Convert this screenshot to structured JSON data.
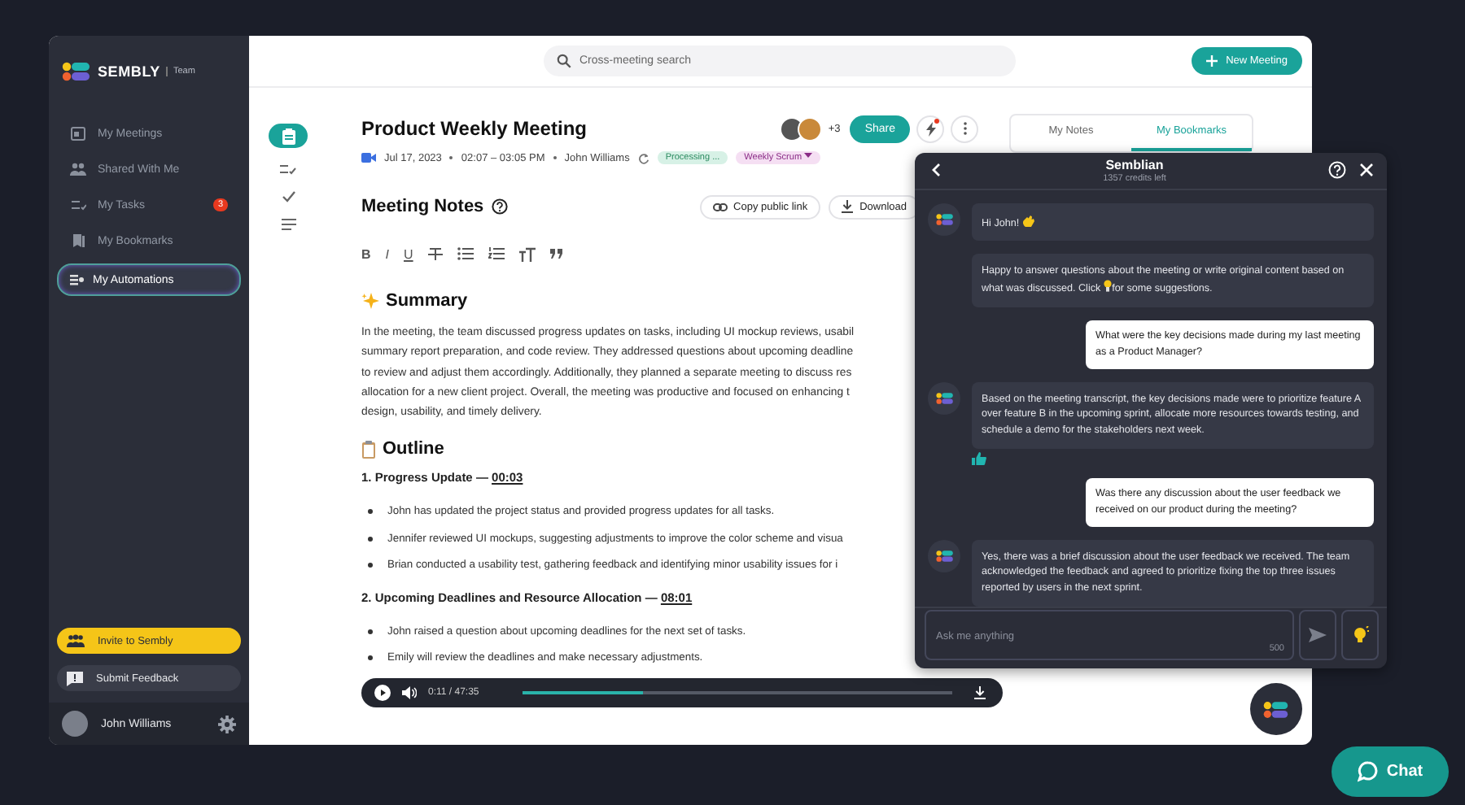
{
  "sidebar": {
    "brand": "SEMBLY",
    "edition": "Team",
    "items": [
      {
        "label": "My Meetings",
        "selected": false
      },
      {
        "label": "Shared With Me",
        "selected": false
      },
      {
        "label": "My Tasks",
        "selected": false,
        "badge": "3"
      },
      {
        "label": "My Bookmarks",
        "selected": false
      },
      {
        "label": "My Automations",
        "selected": true
      }
    ],
    "invite_button": "Invite to Sembly",
    "feedback_button": "Submit Feedback",
    "user_name": "John Williams"
  },
  "search": {
    "placeholder": "Cross-meeting search"
  },
  "new_meeting_button": "New Meeting",
  "meeting": {
    "title": "Product Weekly Meeting",
    "date": "Jul 17, 2023",
    "time": "02:07 – 03:05 PM",
    "host": "John Williams",
    "status_tag": "Processing ...",
    "type_tag": "Weekly Scrum",
    "extra_participants": "+3",
    "share_button": "Share"
  },
  "side_tabs": [
    {
      "label": "My Notes",
      "selected": false
    },
    {
      "label": "My Bookmarks",
      "selected": true
    }
  ],
  "notes": {
    "heading": "Meeting Notes",
    "copy_link_button": "Copy public link",
    "download_button": "Download",
    "toolbar": [
      {
        "kind": "bold",
        "label": "B"
      },
      {
        "kind": "italic",
        "label": "I"
      },
      {
        "kind": "underline",
        "label": "U"
      },
      {
        "kind": "strike"
      },
      {
        "kind": "bullets"
      },
      {
        "kind": "numbered"
      },
      {
        "kind": "textsize"
      },
      {
        "kind": "quote"
      }
    ],
    "summary_heading": "Summary",
    "summary_lines": [
      "In the meeting, the team discussed progress updates on tasks, including UI mockup reviews, usabil",
      "summary report preparation, and code review. They addressed questions about upcoming deadline",
      "to review and adjust them accordingly. Additionally, they planned a separate meeting to discuss res",
      "allocation for a new client project. Overall, the meeting was productive and focused on enhancing t",
      "design, usability, and timely delivery."
    ],
    "outline_heading": "Outline",
    "sections": [
      {
        "title": "1. Progress Update —",
        "timestamp": "00:03",
        "bullets": [
          "John has updated the project status and provided progress updates for all tasks.",
          "Jennifer reviewed UI mockups, suggesting adjustments to improve the color scheme and visua",
          "Brian conducted a usability test, gathering feedback and identifying minor usability issues for i"
        ]
      },
      {
        "title": "2. Upcoming Deadlines and Resource Allocation —",
        "timestamp": "08:01",
        "bullets": [
          "John raised a question about upcoming deadlines for the next set of tasks.",
          "Emily will review the deadlines and make necessary adjustments."
        ]
      }
    ]
  },
  "player": {
    "time": "0:11 / 47:35",
    "level": 0.28
  },
  "assistant": {
    "title": "Semblian",
    "credits": "1357 credits left",
    "messages": [
      {
        "kind": "bot",
        "liked": false,
        "bubbles": [
          {
            "kind": "greeting",
            "text": "Hi John!"
          },
          {
            "kind": "hint",
            "text": "Happy to answer questions about the meeting or write original content based on what was discussed. Click",
            "text_after": "for some suggestions."
          }
        ]
      },
      {
        "kind": "user",
        "bubbles": [
          {
            "text": "What were the key decisions made during my last meeting as a Product Manager?"
          }
        ]
      },
      {
        "kind": "bot",
        "liked": true,
        "bubbles": [
          {
            "text": "Based on the meeting transcript, the key decisions made were to prioritize feature A over feature B in the upcoming sprint, allocate more resources towards testing, and schedule a demo for the stakeholders next week."
          }
        ]
      },
      {
        "kind": "user",
        "bubbles": [
          {
            "text": "Was there any discussion about the user feedback we received on our product during the meeting?"
          }
        ]
      },
      {
        "kind": "bot",
        "liked": false,
        "bubbles": [
          {
            "text": "Yes, there was a brief discussion about the user feedback we received. The team acknowledged the feedback and agreed to prioritize fixing the top three issues reported by users in the next sprint."
          }
        ]
      }
    ],
    "input_placeholder": "Ask me anything",
    "char_limit": "500"
  },
  "chat_button": "Chat"
}
